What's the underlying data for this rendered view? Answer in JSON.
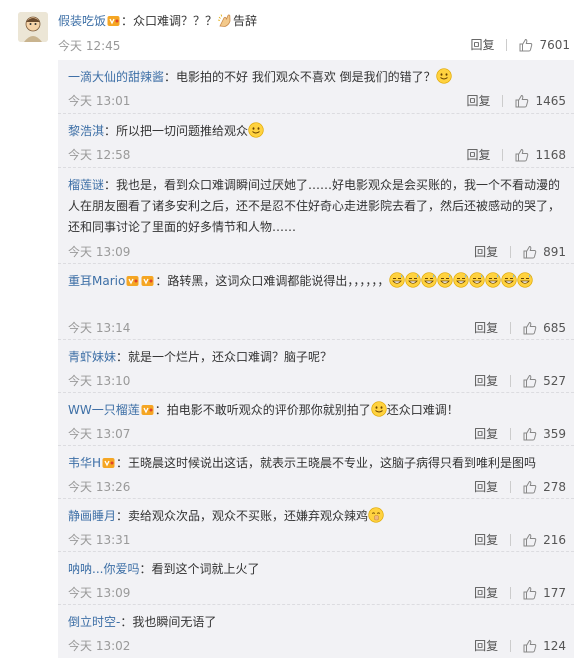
{
  "top": {
    "username": "假装吃饭",
    "text": "众口难调？？？",
    "suffix": "告辞",
    "time": "今天 12:45",
    "reply_label": "回复",
    "likes": "7601"
  },
  "replies": [
    {
      "username": "一滴大仙的甜辣酱",
      "text": "电影拍的不好 我们观众不喜欢 倒是我们的错了？",
      "time": "今天 13:01",
      "reply_label": "回复",
      "likes": "1465"
    },
    {
      "username": "黎浩淇",
      "text": "所以把一切问题推给观众",
      "time": "今天 12:58",
      "reply_label": "回复",
      "likes": "1168"
    },
    {
      "username": "榴莲谜",
      "text": "我也是，看到众口难调瞬间过厌她了……好电影观众是会买账的，我一个不看动漫的人在朋友圈看了诸多安利之后，还不是忍不住好奇心走进影院去看了，然后还被感动的哭了，还和同事讨论了里面的好多情节和人物……",
      "time": "今天 13:09",
      "reply_label": "回复",
      "likes": "891"
    },
    {
      "username": "重耳Mario",
      "text": "路转黑，这词众口难调都能说得出，，，，，，",
      "time": "今天 13:14",
      "reply_label": "回复",
      "likes": "685"
    },
    {
      "username": "青虾妹妹",
      "text": "就是一个烂片，还众口难调？脑子呢？",
      "time": "今天 13:10",
      "reply_label": "回复",
      "likes": "527"
    },
    {
      "username": "WW一只榴莲",
      "text": "拍电影不敢听观众的评价那你就别拍了",
      "suffix": "还众口难调！",
      "time": "今天 13:07",
      "reply_label": "回复",
      "likes": "359"
    },
    {
      "username": "韦华H",
      "text": "王晓晨这时候说出这话，就表示王晓晨不专业，这脑子病得只看到唯利是图吗",
      "time": "今天 13:26",
      "reply_label": "回复",
      "likes": "278"
    },
    {
      "username": "静画睡月",
      "text": "卖给观众次品，观众不买账，还嫌弃观众辣鸡",
      "time": "今天 13:31",
      "reply_label": "回复",
      "likes": "216"
    },
    {
      "username": "呐呐...你爱吗",
      "text": "看到这个词就上火了",
      "time": "今天 13:09",
      "reply_label": "回复",
      "likes": "177"
    },
    {
      "username": "倒立时空-",
      "text": "我也瞬间无语了",
      "time": "今天 13:02",
      "reply_label": "回复",
      "likes": "124"
    }
  ],
  "colors": {
    "username": "#3d6fa6",
    "time": "#999999",
    "reply_bg": "#f2f2f5",
    "badge": "#f5a623"
  },
  "icons": [
    "avatar",
    "vip-badge-icon",
    "smile-emoji-icon",
    "clap-hands-icon",
    "grin-sweat-emoji-icon",
    "hush-emoji-icon",
    "thumb-up-icon"
  ]
}
